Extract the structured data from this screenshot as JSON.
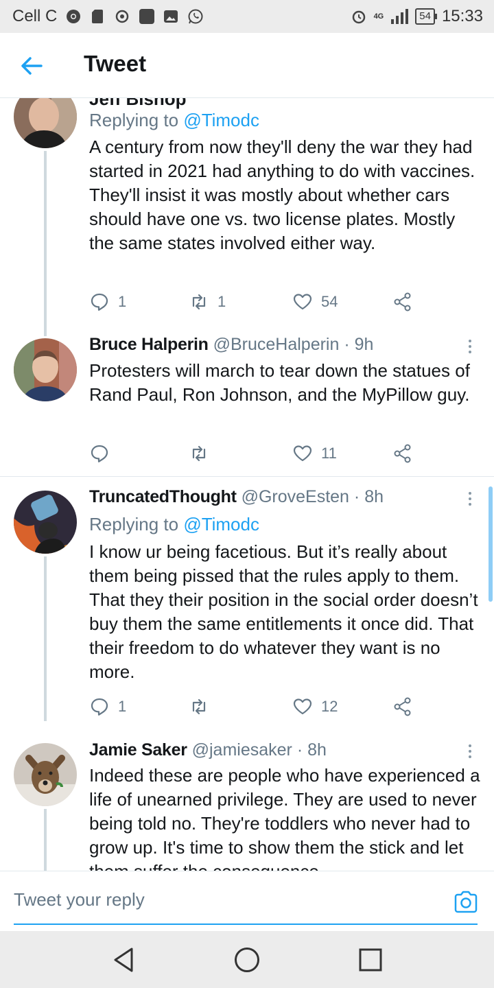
{
  "status": {
    "carrier": "Cell C",
    "time": "15:33",
    "battery": "54",
    "network": "4G"
  },
  "header": {
    "title": "Tweet"
  },
  "clipped_tweet": {
    "name": "Jeff Bishop"
  },
  "tweets": [
    {
      "replying_prefix": "Replying to ",
      "replying_to": "@Timodc",
      "text": "A century from now they'll deny the war they had started in 2021 had anything to do with vaccines. They'll insist it was mostly about whether cars should have one vs. two license plates. Mostly the same states involved either way.",
      "replies": "1",
      "retweets": "1",
      "likes": "54"
    },
    {
      "name": "Bruce Halperin",
      "handle": "@BruceHalperin",
      "sep": "·",
      "time": "9h",
      "text": "Protesters will march to tear down the statues of Rand Paul, Ron Johnson, and the MyPillow guy.",
      "replies": "",
      "retweets": "",
      "likes": "11"
    },
    {
      "name": "TruncatedThought",
      "handle": "@GroveEsten",
      "sep": "·",
      "time": "8h",
      "replying_prefix": "Replying to ",
      "replying_to": "@Timodc",
      "text": "I know ur being facetious. But it’s really about them being pissed that the rules apply to them. That they their position in the social order doesn’t buy them the same entitlements it once did. That their freedom to do whatever they want is no more.",
      "replies": "1",
      "retweets": "",
      "likes": "12"
    },
    {
      "name": "Jamie Saker",
      "handle": "@jamiesaker",
      "sep": "·",
      "time": "8h",
      "text": "Indeed these are people who have experienced a life of unearned privilege. They are used to never being told no. They're toddlers who never had to grow up. It's time to show them the stick and let them suffer the consequence"
    }
  ],
  "reply": {
    "placeholder": "Tweet your reply"
  },
  "colors": {
    "accent": "#1da1f2",
    "muted": "#657786",
    "text": "#14171a"
  }
}
